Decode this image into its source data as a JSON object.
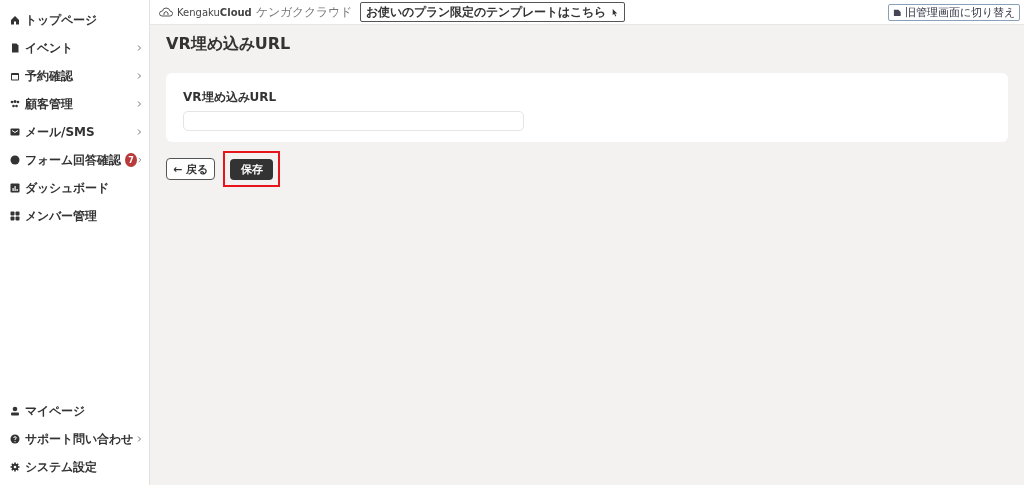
{
  "sidebar": {
    "items": [
      {
        "label": "トップページ",
        "has_submenu": false
      },
      {
        "label": "イベント",
        "has_submenu": true
      },
      {
        "label": "予約確認",
        "has_submenu": true
      },
      {
        "label": "顧客管理",
        "has_submenu": true
      },
      {
        "label": "メール/SMS",
        "has_submenu": true
      },
      {
        "label": "フォーム回答確認",
        "has_submenu": true,
        "badge": "7"
      },
      {
        "label": "ダッシュボード",
        "has_submenu": false
      },
      {
        "label": "メンバー管理",
        "has_submenu": false
      }
    ],
    "bottom_items": [
      {
        "label": "マイページ",
        "has_submenu": false
      },
      {
        "label": "サポート問い合わせ",
        "has_submenu": true
      },
      {
        "label": "システム設定",
        "has_submenu": false
      }
    ]
  },
  "header": {
    "logo": {
      "name_light": "Kengaku",
      "name_bold": "Cloud",
      "reading": "ケンガククラウド"
    },
    "template_button": "お使いのプラン限定のテンプレートはこちら",
    "switch_button": "旧管理画面に切り替え"
  },
  "page": {
    "title": "VR埋め込みURL",
    "field": {
      "label": "VR埋め込みURL"
    },
    "back_button": "← 戻る",
    "save_button": {
      "label": "保存",
      "highlighted": true
    }
  }
}
